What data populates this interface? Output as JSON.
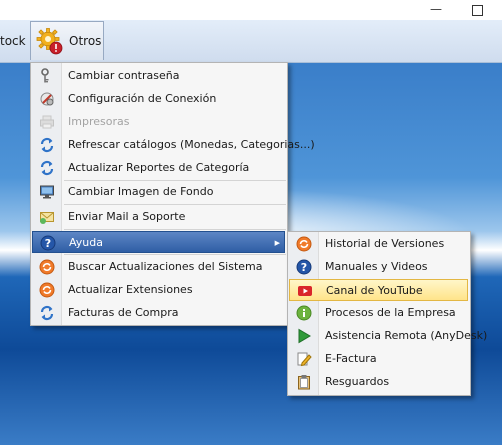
{
  "window": {
    "minimize_glyph": "—",
    "maximize_glyph": ""
  },
  "menubar": {
    "stock_label": "tock",
    "otros_label": "Otros",
    "otros_icon": "gear-alert-icon"
  },
  "main_menu": {
    "items": [
      {
        "label": "Cambiar contraseña",
        "icon": "key-icon",
        "disabled": false
      },
      {
        "label": "Configuración de Conexión",
        "icon": "connection-settings-icon",
        "disabled": false
      },
      {
        "label": "Impresoras",
        "icon": "printer-icon",
        "disabled": true
      },
      {
        "label": "Refrescar catálogos (Monedas, Categorias...)",
        "icon": "refresh-icon",
        "disabled": false
      },
      {
        "label": "Actualizar Reportes de Categoría",
        "icon": "refresh-icon",
        "disabled": false
      },
      {
        "label": "Cambiar Imagen de Fondo",
        "icon": "monitor-icon",
        "disabled": false
      },
      {
        "label": "Enviar Mail a Soporte",
        "icon": "mail-icon",
        "disabled": false
      },
      {
        "label": "Ayuda",
        "icon": "help-icon",
        "disabled": false,
        "has_submenu": true,
        "submenu_arrow": "▶"
      },
      {
        "label": "Buscar Actualizaciones del Sistema",
        "icon": "update-icon",
        "disabled": false
      },
      {
        "label": "Actualizar Extensiones",
        "icon": "update-icon",
        "disabled": false
      },
      {
        "label": "Facturas de Compra",
        "icon": "refresh-icon",
        "disabled": false
      }
    ]
  },
  "help_submenu": {
    "items": [
      {
        "label": "Historial de Versiones",
        "icon": "update-icon"
      },
      {
        "label": "Manuales y Videos",
        "icon": "help-icon"
      },
      {
        "label": "Canal de YouTube",
        "icon": "youtube-icon"
      },
      {
        "label": "Procesos de la Empresa",
        "icon": "info-icon"
      },
      {
        "label": "Asistencia Remota (AnyDesk)",
        "icon": "play-icon"
      },
      {
        "label": "E-Factura",
        "icon": "document-edit-icon"
      },
      {
        "label": "Resguardos",
        "icon": "clipboard-icon"
      }
    ]
  },
  "colors": {
    "accent": "#2f5ea5",
    "hover": "#ffe48a",
    "menu_bg": "#f6f6f6"
  }
}
